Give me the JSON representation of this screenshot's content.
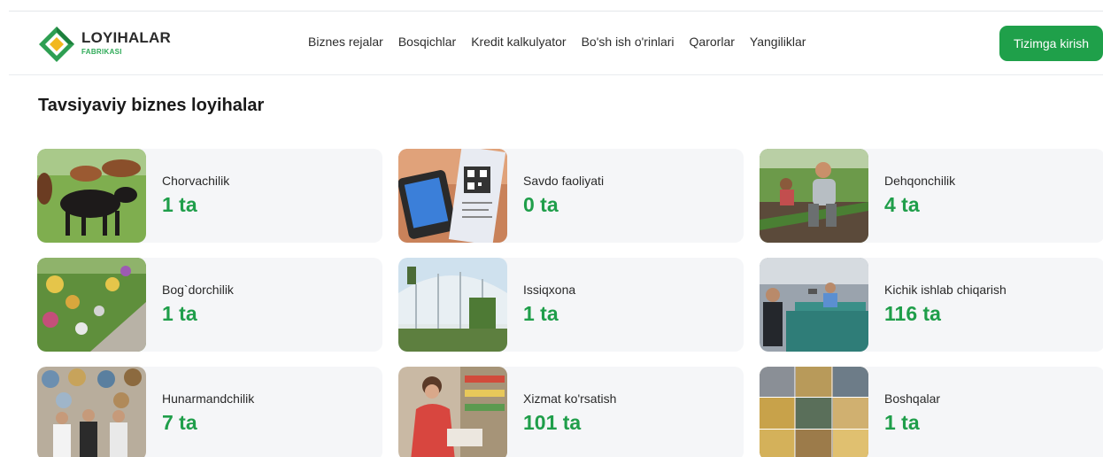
{
  "header": {
    "logo_title": "LOYIHALAR",
    "logo_subtitle": "FABRIKASI",
    "nav": [
      "Biznes rejalar",
      "Bosqichlar",
      "Kredit kalkulyator",
      "Bo'sh ish o'rinlari",
      "Qarorlar",
      "Yangiliklar"
    ],
    "login_label": "Tizimga kirish"
  },
  "section_title": "Tavsiyaviy biznes loyihalar",
  "cards": [
    {
      "label": "Chorvachilik",
      "count": "1 ta"
    },
    {
      "label": "Savdo faoliyati",
      "count": "0 ta"
    },
    {
      "label": "Dehqonchilik",
      "count": "4 ta"
    },
    {
      "label": "Bog`dorchilik",
      "count": "1 ta"
    },
    {
      "label": "Issiqxona",
      "count": "1 ta"
    },
    {
      "label": "Kichik ishlab chiqarish",
      "count": "116 ta"
    },
    {
      "label": "Hunarmandchilik",
      "count": "7 ta"
    },
    {
      "label": "Xizmat ko'rsatish",
      "count": "101 ta"
    },
    {
      "label": "Boshqalar",
      "count": "1 ta"
    }
  ],
  "colors": {
    "accent": "#1fa04a",
    "count": "#1f9e4a",
    "card_bg": "#f5f6f8"
  }
}
